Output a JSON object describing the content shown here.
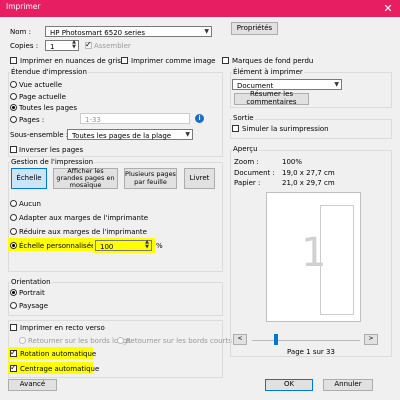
{
  "window": {
    "title": "Imprimer",
    "close_glyph": "✕"
  },
  "printer": {
    "name_label": "Nom :",
    "name_value": "HP Photosmart 6520 series",
    "properties_button": "Propriétés",
    "copies_label": "Copies :",
    "copies_value": "1",
    "collate_label": "Assembler",
    "collate_checked": true,
    "collate_disabled": true,
    "grayscale_label": "Imprimer en nuances de gris",
    "grayscale_checked": false,
    "print_as_image_label": "Imprimer comme image",
    "print_as_image_checked": false,
    "bg_marks_label": "Marques de fond perdu",
    "bg_marks_checked": false
  },
  "range": {
    "title": "Étendue d'impression",
    "current_view": "Vue actuelle",
    "current_page": "Page actuelle",
    "all_pages": "Toutes les pages",
    "pages_label": "Pages :",
    "pages_value": "1-33",
    "subset_label": "Sous-ensemble :",
    "subset_value": "Toutes les pages de la plage",
    "reverse_label": "Inverser les pages",
    "selected": "all_pages",
    "info_icon": "info-icon"
  },
  "handling": {
    "title": "Gestion de l'impression",
    "buttons": {
      "scale": "Échelle",
      "large_pages": "Afficher les grandes pages en mosaïque",
      "multiple_pages": "Plusieurs pages par feuille",
      "booklet": "Livret"
    },
    "none": "Aucun",
    "fit_margins": "Adapter aux marges de l'imprimante",
    "shrink_margins": "Réduire aux marges de l'imprimante",
    "custom_scale": "Échelle personnalisée",
    "custom_value": "100",
    "percent": "%",
    "selected": "custom_scale"
  },
  "orientation": {
    "title": "Orientation",
    "portrait": "Portrait",
    "landscape": "Paysage",
    "selected": "portrait"
  },
  "duplex": {
    "recto_verso_label": "Imprimer en recto verso",
    "recto_verso_checked": false,
    "long_edge": "Retourner sur les bords longs",
    "short_edge": "Retourner sur les bords courts",
    "auto_rotate": "Rotation automatique",
    "auto_rotate_checked": true,
    "auto_center": "Centrage automatique",
    "auto_center_checked": true
  },
  "print_item": {
    "title": "Élément à imprimer",
    "value": "Document",
    "summary_button": "Résumer les commentaires"
  },
  "output": {
    "title": "Sortie",
    "simulate_label": "Simuler la surimpression",
    "simulate_checked": false
  },
  "preview": {
    "title": "Aperçu",
    "zoom_label": "Zoom :",
    "zoom_value": "100%",
    "document_label": "Document :",
    "document_value": "19,0 x 27,7 cm",
    "paper_label": "Papier :",
    "paper_value": "21,0 x 29,7 cm",
    "page_glyph": "1",
    "page_indicator": "Page 1 sur 33",
    "slider_position": 0
  },
  "footer": {
    "advanced": "Avancé",
    "ok": "OK",
    "cancel": "Annuler"
  },
  "colors": {
    "titlebar": "#e81e63",
    "highlight": "#ffff00",
    "accent": "#0078d7"
  }
}
